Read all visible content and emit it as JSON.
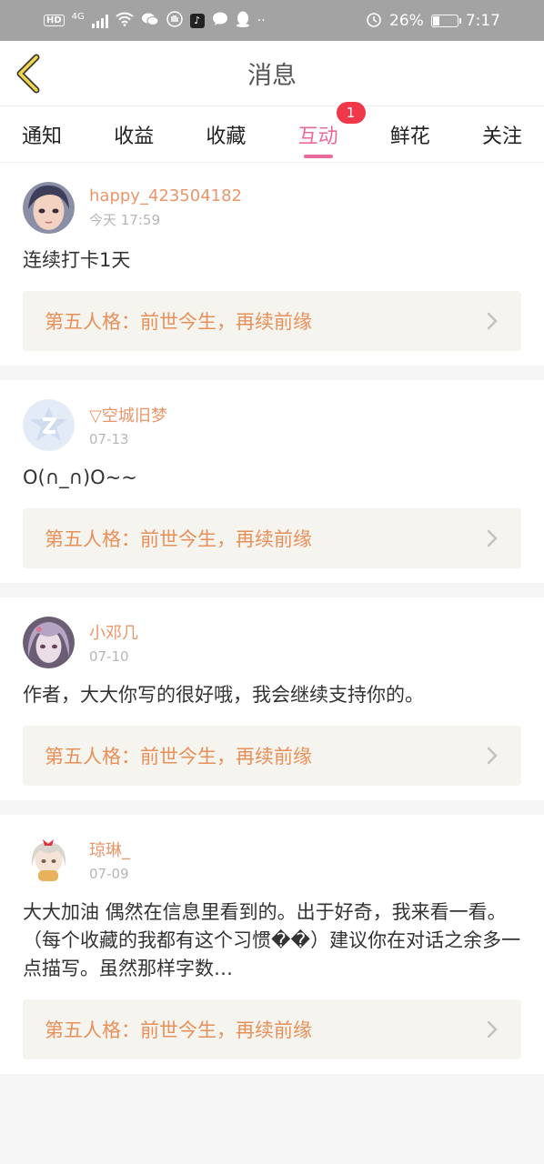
{
  "status_bar": {
    "hd": "HD",
    "net": "4G",
    "battery_pct": "26%",
    "battery_level": 0.26,
    "time": "7:17"
  },
  "header": {
    "title": "消息"
  },
  "tabs": [
    {
      "label": "通知",
      "active": false
    },
    {
      "label": "收益",
      "active": false
    },
    {
      "label": "收藏",
      "active": false
    },
    {
      "label": "互动",
      "active": true,
      "badge": "1"
    },
    {
      "label": "鲜花",
      "active": false
    },
    {
      "label": "关注",
      "active": false
    }
  ],
  "items": [
    {
      "user": "happy_423504182",
      "date": "今天 17:59",
      "comment": "连续打卡1天",
      "novel": "第五人格：前世今生，再续前缘",
      "avatar": "anime-girl-dark-hair-avatar"
    },
    {
      "user": "▽空城旧梦",
      "date": "07-13",
      "comment": "O(∩_∩)O~~",
      "novel": "第五人格：前世今生，再续前缘",
      "avatar": "default-qq-avatar"
    },
    {
      "user": "小邓几",
      "date": "07-10",
      "comment": "作者，大大你写的很好哦，我会继续支持你的。",
      "novel": "第五人格：前世今生，再续前缘",
      "avatar": "anime-girl-purple-avatar"
    },
    {
      "user": "琼琳_",
      "date": "07-09",
      "comment": "大大加油 偶然在信息里看到的。出于好奇，我来看一看。（每个收藏的我都有这个习惯��）建议你在对话之余多一点描写。虽然那样字数…",
      "novel": "第五人格：前世今生，再续前缘",
      "avatar": "anime-girl-white-hair-avatar"
    }
  ],
  "colors": {
    "accent": "#e96a9a",
    "username": "#e9966a",
    "novel_link": "#e8905a",
    "badge": "#f0384a"
  }
}
